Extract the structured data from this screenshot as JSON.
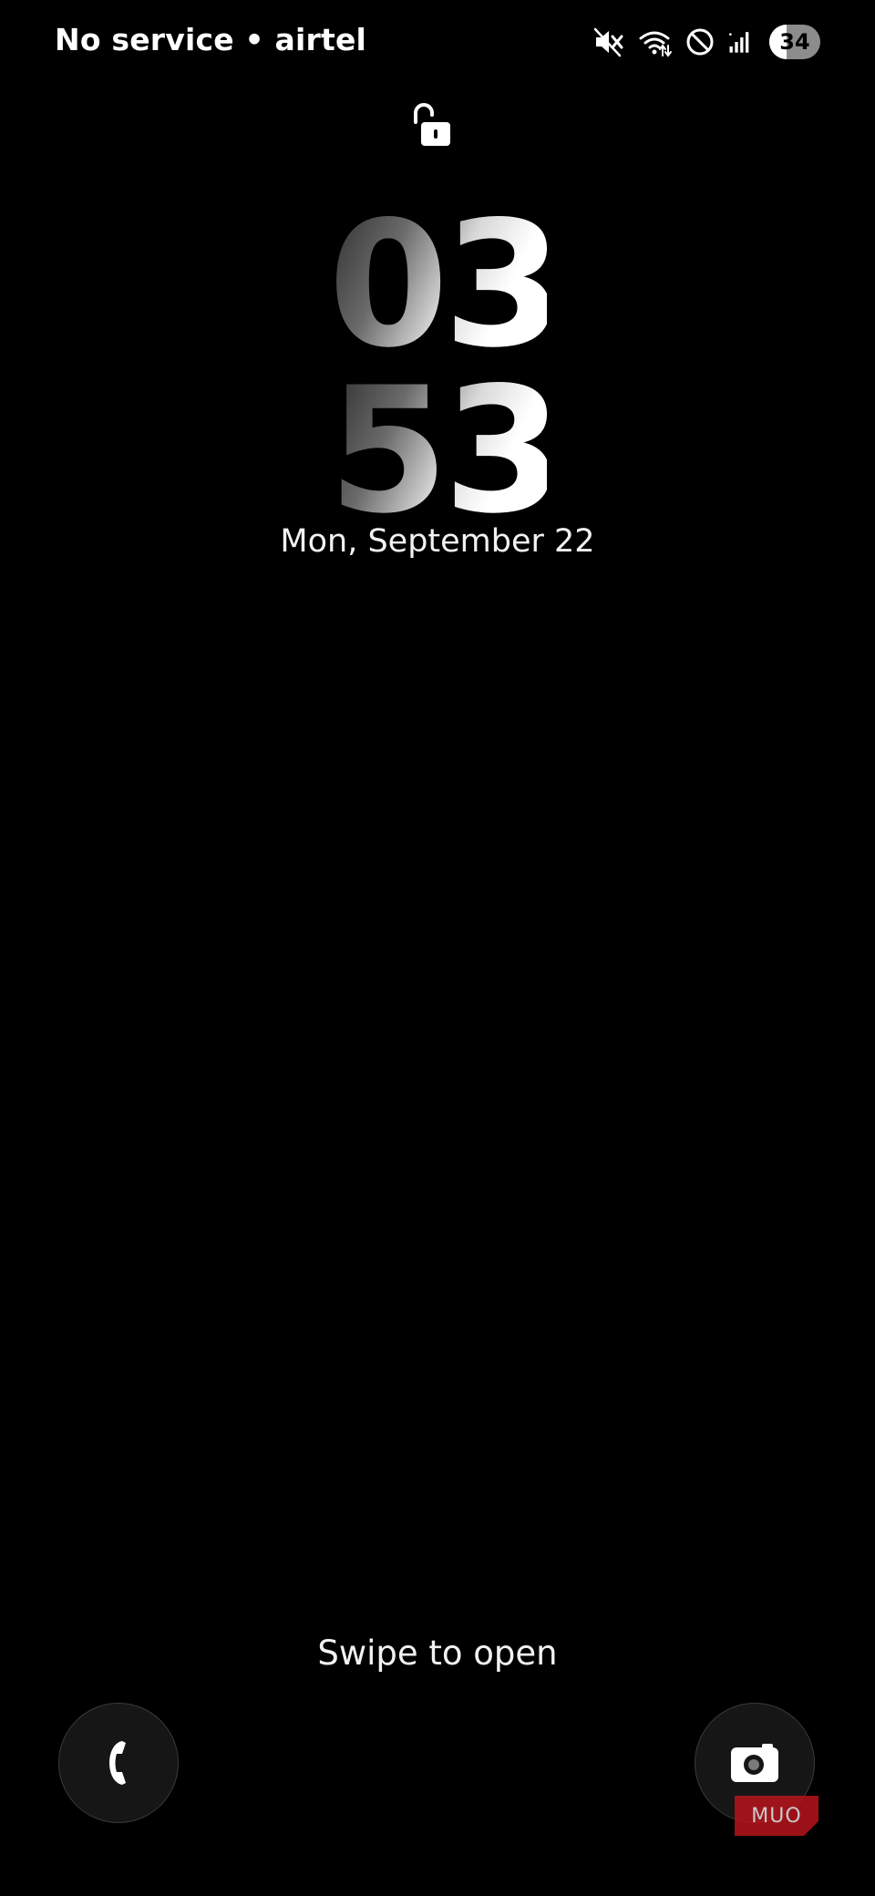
{
  "status_bar": {
    "carrier": "No service • airtel",
    "battery": {
      "level": 34,
      "label": "34"
    },
    "icons": [
      "mute-icon",
      "wifi-icon",
      "do-not-disturb-icon",
      "signal-icon",
      "battery-icon"
    ]
  },
  "lock": {
    "icon": "unlocked-padlock-icon"
  },
  "clock": {
    "hours": "03",
    "minutes": "53"
  },
  "date": "Mon, September 22",
  "swipe_hint": "Swipe to open",
  "shortcuts": {
    "left": {
      "icon": "phone-icon"
    },
    "right": {
      "icon": "camera-icon"
    }
  },
  "watermark": {
    "text": "MUO"
  },
  "colors": {
    "background": "#000000",
    "text": "#ffffff",
    "shortcut_bg": "#161616",
    "watermark": "#b8141c"
  }
}
